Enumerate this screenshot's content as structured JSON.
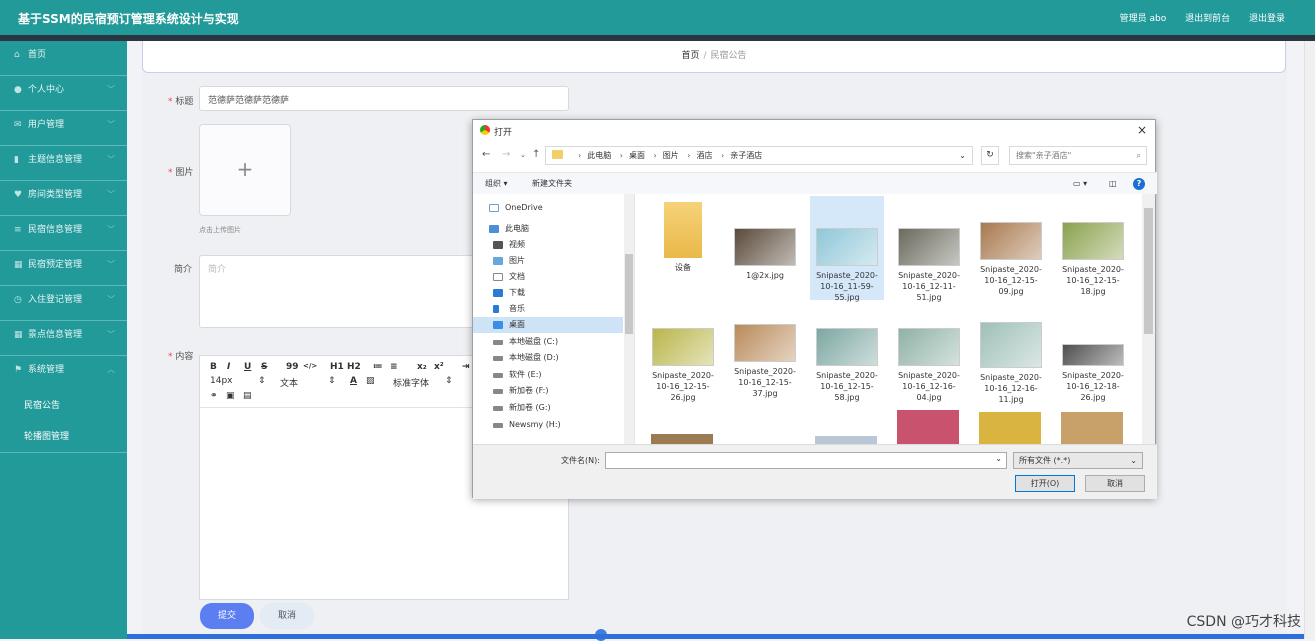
{
  "app": {
    "title": "基于SSM的民宿预订管理系统设计与实现",
    "user_label": "管理员 abo",
    "to_frontend": "退出到前台",
    "logout": "退出登录"
  },
  "sidebar": {
    "items": [
      {
        "label": "首页",
        "icon": "home-icon"
      },
      {
        "label": "个人中心",
        "icon": "user-icon"
      },
      {
        "label": "用户管理",
        "icon": "mail-icon"
      },
      {
        "label": "主题信息管理",
        "icon": "bar-chart-icon"
      },
      {
        "label": "房间类型管理",
        "icon": "shield-icon"
      },
      {
        "label": "民宿信息管理",
        "icon": "list-icon"
      },
      {
        "label": "民宿预定管理",
        "icon": "grid-icon"
      },
      {
        "label": "入住登记管理",
        "icon": "clock-icon"
      },
      {
        "label": "景点信息管理",
        "icon": "grid-icon"
      },
      {
        "label": "系统管理",
        "icon": "flag-icon"
      }
    ],
    "subitems": [
      "民宿公告",
      "轮播图管理"
    ]
  },
  "breadcrumb": {
    "home": "首页",
    "sep": "/",
    "current": "民宿公告"
  },
  "form": {
    "title_label": "标题",
    "title_value": "范德萨范德萨范德萨",
    "image_label": "图片",
    "upload_plus": "+",
    "upload_hint": "点击上传图片",
    "summary_label": "简介",
    "summary_placeholder": "简介",
    "content_label": "内容",
    "toolbar_row1": [
      "B",
      "I",
      "U",
      "S",
      "99",
      "</>",
      "H1",
      "H2",
      "≔",
      "≡",
      "x₂",
      "x²",
      "⇥"
    ],
    "font_size": "14px",
    "text_style": "文本",
    "font_family": "标准字体",
    "submit": "提交",
    "cancel": "取消"
  },
  "dialog": {
    "title": "打开",
    "close": "×",
    "path": [
      "此电脑",
      "桌面",
      "图片",
      "酒店",
      "亲子酒店"
    ],
    "search_placeholder": "搜索\"亲子酒店\"",
    "organize": "组织 ▾",
    "new_folder": "新建文件夹",
    "nav": [
      {
        "label": "OneDrive",
        "icon": "cloud-icon"
      },
      {
        "label": "此电脑",
        "icon": "computer-icon"
      },
      {
        "label": "视频",
        "icon": "video-icon"
      },
      {
        "label": "图片",
        "icon": "picture-icon"
      },
      {
        "label": "文档",
        "icon": "document-icon"
      },
      {
        "label": "下载",
        "icon": "download-icon"
      },
      {
        "label": "音乐",
        "icon": "music-icon"
      },
      {
        "label": "桌面",
        "icon": "desktop-icon"
      },
      {
        "label": "本地磁盘 (C:)",
        "icon": "drive-icon"
      },
      {
        "label": "本地磁盘 (D:)",
        "icon": "drive-icon"
      },
      {
        "label": "软件 (E:)",
        "icon": "drive-icon"
      },
      {
        "label": "新加卷 (F:)",
        "icon": "drive-icon"
      },
      {
        "label": "新加卷 (G:)",
        "icon": "drive-icon"
      },
      {
        "label": "Newsmy (H:)",
        "icon": "drive-icon"
      }
    ],
    "files": [
      {
        "name": "设备",
        "kind": "folder"
      },
      {
        "name": "1@2x.jpg",
        "kind": "image",
        "color": "#5a4a3a"
      },
      {
        "name": "Snipaste_2020-10-16_11-59-55.jpg",
        "kind": "image",
        "color": "#8fc7d8",
        "selected": true
      },
      {
        "name": "Snipaste_2020-10-16_12-11-51.jpg",
        "kind": "image",
        "color": "#6b6a5e"
      },
      {
        "name": "Snipaste_2020-10-16_12-15-09.jpg",
        "kind": "image",
        "color": "#a8794e"
      },
      {
        "name": "Snipaste_2020-10-16_12-15-18.jpg",
        "kind": "image",
        "color": "#8aa24d"
      },
      {
        "name": "Snipaste_2020-10-16_12-15-26.jpg",
        "kind": "image",
        "color": "#b9b64a"
      },
      {
        "name": "Snipaste_2020-10-16_12-15-37.jpg",
        "kind": "image",
        "color": "#b98b5a"
      },
      {
        "name": "Snipaste_2020-10-16_12-15-58.jpg",
        "kind": "image",
        "color": "#7da7a3"
      },
      {
        "name": "Snipaste_2020-10-16_12-16-04.jpg",
        "kind": "image",
        "color": "#8fb2a6"
      },
      {
        "name": "Snipaste_2020-10-16_12-16-11.jpg",
        "kind": "image",
        "color": "#9fc0b8"
      },
      {
        "name": "Snipaste_2020-10-16_12-18-26.jpg",
        "kind": "image",
        "color": "#4f4f4f"
      }
    ],
    "filename_label": "文件名(N):",
    "filename_value": "",
    "filetype": "所有文件 (*.*)",
    "open_button": "打开(O)",
    "cancel_button": "取消"
  },
  "watermark": "CSDN @巧才科技"
}
